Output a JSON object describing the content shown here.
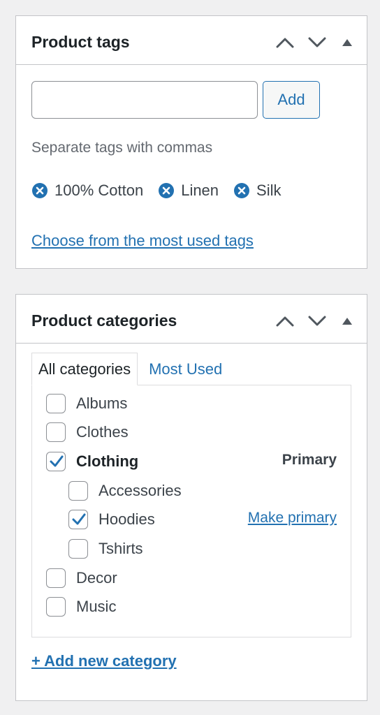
{
  "tags_box": {
    "title": "Product tags",
    "input_value": "",
    "add_label": "Add",
    "howto": "Separate tags with commas",
    "tags": [
      {
        "label": "100% Cotton"
      },
      {
        "label": "Linen"
      },
      {
        "label": "Silk"
      }
    ],
    "most_used_link": "Choose from the most used tags"
  },
  "categories_box": {
    "title": "Product categories",
    "tabs": [
      {
        "label": "All categories",
        "active": true
      },
      {
        "label": "Most Used",
        "active": false
      }
    ],
    "categories": [
      {
        "label": "Albums",
        "checked": false,
        "level": 0
      },
      {
        "label": "Clothes",
        "checked": false,
        "level": 0
      },
      {
        "label": "Clothing",
        "checked": true,
        "level": 0,
        "bold": true,
        "badge": "Primary"
      },
      {
        "label": "Accessories",
        "checked": false,
        "level": 1
      },
      {
        "label": "Hoodies",
        "checked": true,
        "level": 1,
        "action": "Make primary"
      },
      {
        "label": "Tshirts",
        "checked": false,
        "level": 1
      },
      {
        "label": "Decor",
        "checked": false,
        "level": 0
      },
      {
        "label": "Music",
        "checked": false,
        "level": 0
      }
    ],
    "add_new_link": "+ Add new category"
  },
  "colors": {
    "accent": "#2271b1",
    "text": "#3c434a",
    "muted": "#646970",
    "border": "#c3c4c7",
    "icon": "#50575e"
  },
  "icons": {
    "move_up": "chevron-up-icon",
    "move_down": "chevron-down-icon",
    "toggle": "triangle-up-icon",
    "tag_remove": "remove-circle-icon",
    "checkmark": "checkmark-icon"
  }
}
